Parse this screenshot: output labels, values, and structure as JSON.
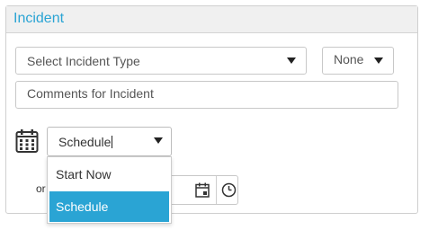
{
  "panel": {
    "title": "Incident"
  },
  "incident_type": {
    "placeholder": "Select Incident Type"
  },
  "priority": {
    "value": "None"
  },
  "comments": {
    "placeholder": "Comments for Incident"
  },
  "schedule": {
    "value": "Schedule",
    "options": [
      "Start Now",
      "Schedule"
    ],
    "selected_option": "Schedule"
  },
  "datetime_row": {
    "prefix_text": "or"
  },
  "colors": {
    "accent": "#2aa4d4",
    "header_bg": "#f0f0f0",
    "border": "#c8c8c8"
  },
  "icons": [
    "calendar-icon",
    "chevron-down-icon",
    "date-picker-icon",
    "clock-icon"
  ]
}
